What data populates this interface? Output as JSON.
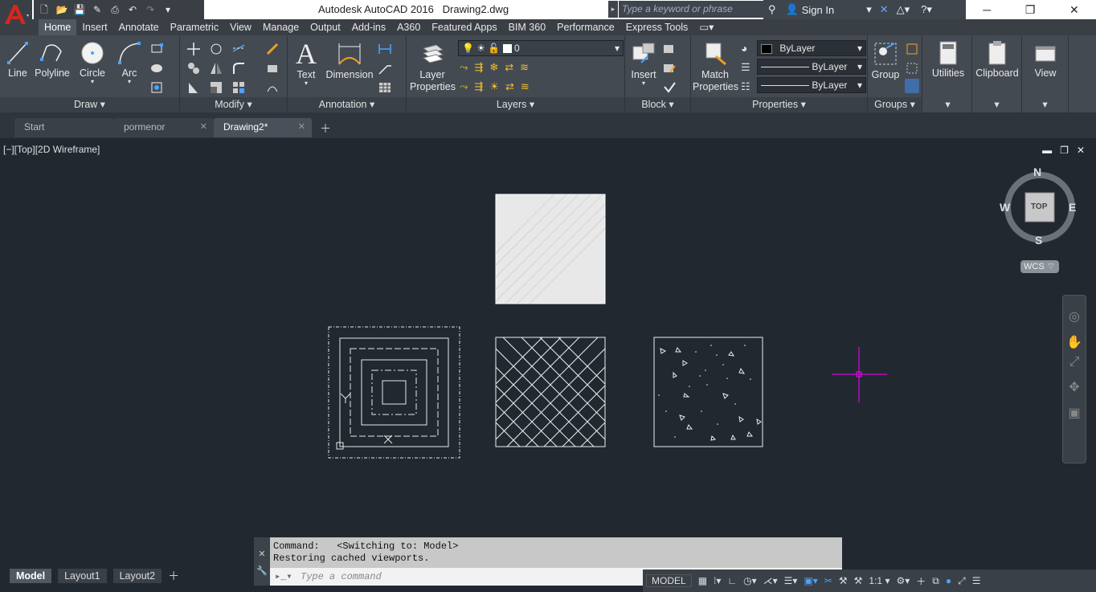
{
  "window": {
    "app_title": "Autodesk AutoCAD 2016",
    "file_name": "Drawing2.dwg"
  },
  "search": {
    "placeholder": "Type a keyword or phrase"
  },
  "account": {
    "sign_in": "Sign In"
  },
  "ribbon_tabs": [
    "Home",
    "Insert",
    "Annotate",
    "Parametric",
    "View",
    "Manage",
    "Output",
    "Add-ins",
    "A360",
    "Featured Apps",
    "BIM 360",
    "Performance",
    "Express Tools"
  ],
  "draw": {
    "title": "Draw",
    "line": "Line",
    "polyline": "Polyline",
    "circle": "Circle",
    "arc": "Arc"
  },
  "modify": {
    "title": "Modify"
  },
  "annotation": {
    "title": "Annotation",
    "text": "Text",
    "dimension": "Dimension"
  },
  "layers": {
    "title": "Layers",
    "layer_properties_l1": "Layer",
    "layer_properties_l2": "Properties",
    "current_layer": "0"
  },
  "block": {
    "title": "Block",
    "insert": "Insert"
  },
  "properties": {
    "title": "Properties",
    "match_l1": "Match",
    "match_l2": "Properties",
    "color": "ByLayer",
    "linetype": "ByLayer",
    "lineweight": "ByLayer"
  },
  "groups": {
    "title": "Groups",
    "group": "Group"
  },
  "utilities": {
    "label": "Utilities"
  },
  "clipboard": {
    "label": "Clipboard"
  },
  "view": {
    "label": "View"
  },
  "doc_tabs": [
    {
      "label": "Start"
    },
    {
      "label": "pormenor"
    },
    {
      "label": "Drawing2*"
    }
  ],
  "viewport": {
    "label": "[−][Top][2D Wireframe]"
  },
  "viewcube": {
    "n": "N",
    "s": "S",
    "e": "E",
    "w": "W",
    "top": "TOP",
    "wcs": "WCS"
  },
  "command": {
    "line1": "Command:   <Switching to: Model>",
    "line2": "Restoring cached viewports.",
    "placeholder": "Type a command"
  },
  "layouts": [
    "Model",
    "Layout1",
    "Layout2"
  ],
  "status": {
    "model": "MODEL",
    "scale": "1:1"
  }
}
